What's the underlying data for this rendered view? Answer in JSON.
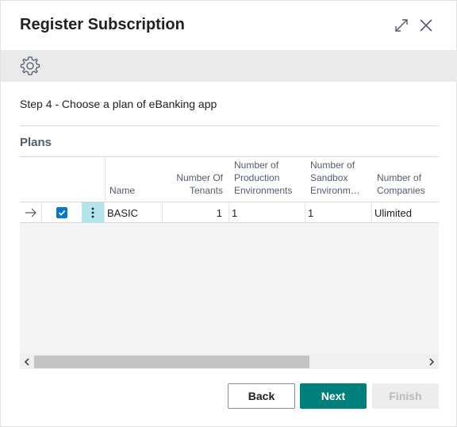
{
  "dialog": {
    "title": "Register Subscription",
    "step_text": "Step 4 - Choose a plan of eBanking app",
    "section_title": "Plans"
  },
  "grid": {
    "columns": [
      {
        "key": "name",
        "label": "Name"
      },
      {
        "key": "tenants",
        "label_lines": [
          "Number Of",
          "Tenants"
        ]
      },
      {
        "key": "prod_envs",
        "label_lines": [
          "Number of",
          "Production",
          "Environments"
        ]
      },
      {
        "key": "sandbox_envs",
        "label_lines": [
          "Number of",
          "Sandbox",
          "Environm…"
        ]
      },
      {
        "key": "companies",
        "label_lines": [
          "Number of",
          "Companies"
        ]
      }
    ],
    "rows": [
      {
        "selected": true,
        "name": "BASIC",
        "tenants": "1",
        "prod_envs": "1",
        "sandbox_envs": "1",
        "companies": "Ulimited"
      }
    ]
  },
  "buttons": {
    "back": "Back",
    "next": "Next",
    "finish": "Finish"
  },
  "icons": {
    "settings": "gear-icon",
    "expand": "expand-icon",
    "close": "close-icon",
    "row_indicator": "arrow-right-icon",
    "row_actions": "more-vertical-icon"
  },
  "colors": {
    "primary": "#00807d",
    "checkbox": "#0078d4",
    "actions_cell": "#b5e5ec",
    "toolbar": "#eaeaea"
  }
}
